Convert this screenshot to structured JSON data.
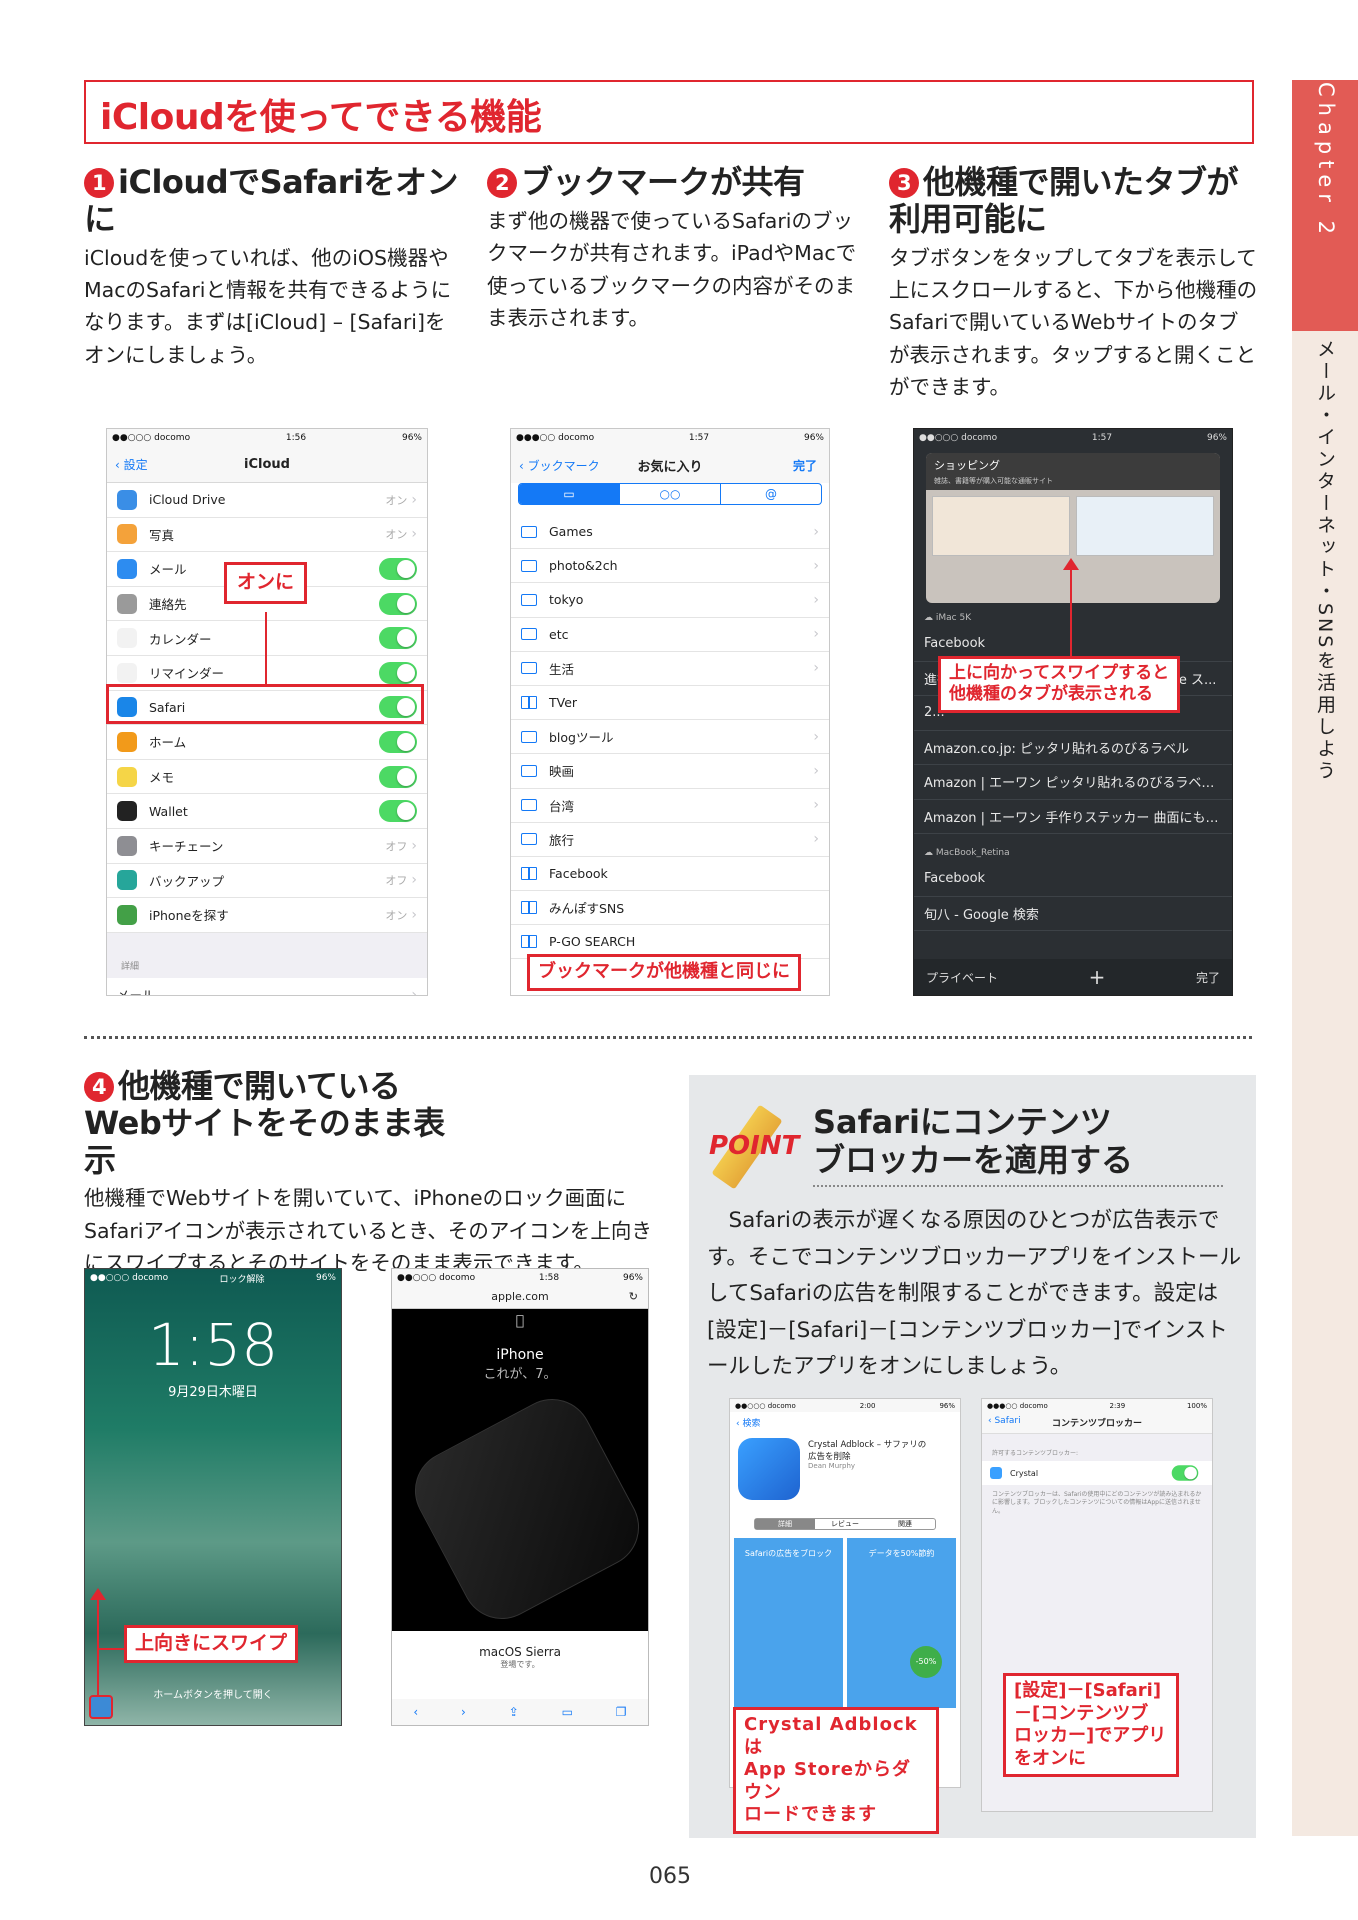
{
  "chapter": "Chapter 2",
  "category": "メール・インターネット・SNSを活用しよう",
  "page_number": "065",
  "main_title": "iCloudを使ってできる機能",
  "steps": [
    {
      "num": "1",
      "title": "iCloudでSafariをオンに",
      "body": "iCloudを使っていれば、他のiOS機器やMacのSafariと情報を共有できるようになります。まずは[iCloud] – [Safari]をオンにしましょう。"
    },
    {
      "num": "2",
      "title": "ブックマークが共有",
      "body": "まず他の機器で使っているSafariのブックマークが共有されます。iPadやMacで使っているブックマークの内容がそのまま表示されます。"
    },
    {
      "num": "3",
      "title": "他機種で開いたタブが利用可能に",
      "body": "タブボタンをタップしてタブを表示して上にスクロールすると、下から他機種のSafariで開いているWebサイトのタブが表示されます。タップすると開くことができます。"
    },
    {
      "num": "4",
      "title": "他機種で開いているWebサイトをそのまま表示",
      "body": "他機種でWebサイトを開いていて、iPhoneのロック画面にSafariアイコンが表示されているとき、そのアイコンを上向きにスワイプするとそのサイトをそのまま表示できます。"
    }
  ],
  "phone1": {
    "status": {
      "carrier": "●●○○○ docomo",
      "time": "1:56",
      "battery": "96%"
    },
    "back": "設定",
    "title": "iCloud",
    "rows": [
      {
        "label": "iCloud Drive",
        "value": "オン",
        "icon": "cloud-icon",
        "color": "#3a8ee6"
      },
      {
        "label": "写真",
        "value": "オン",
        "icon": "photos-icon",
        "color": "#f4a23a"
      },
      {
        "label": "メール",
        "toggle": true,
        "icon": "mail-icon",
        "color": "#2d8cf0"
      },
      {
        "label": "連絡先",
        "toggle": true,
        "icon": "contacts-icon",
        "color": "#9a9a9a"
      },
      {
        "label": "カレンダー",
        "toggle": true,
        "icon": "calendar-icon",
        "color": "#f2f2f2"
      },
      {
        "label": "リマインダー",
        "toggle": true,
        "icon": "reminders-icon",
        "color": "#f2f2f2"
      },
      {
        "label": "Safari",
        "toggle": true,
        "icon": "safari-icon",
        "color": "#1a86e8"
      },
      {
        "label": "ホーム",
        "toggle": true,
        "icon": "home-icon",
        "color": "#f29a1a"
      },
      {
        "label": "メモ",
        "toggle": true,
        "icon": "notes-icon",
        "color": "#f5d547"
      },
      {
        "label": "Wallet",
        "toggle": true,
        "icon": "wallet-icon",
        "color": "#222"
      },
      {
        "label": "キーチェーン",
        "value": "オフ",
        "icon": "keychain-icon",
        "color": "#8e8e93"
      },
      {
        "label": "バックアップ",
        "value": "オフ",
        "icon": "backup-icon",
        "color": "#26a69a"
      },
      {
        "label": "iPhoneを探す",
        "value": "オン",
        "icon": "find-iphone-icon",
        "color": "#43a047"
      }
    ],
    "section": "詳細",
    "footer_row": "メール",
    "callout": "オンに"
  },
  "phone2": {
    "status": {
      "carrier": "●●●○○ docomo",
      "time": "1:57",
      "battery": "96%"
    },
    "back": "ブックマーク",
    "title": "お気に入り",
    "done": "完了",
    "tabs": [
      "book-icon",
      "glasses-icon",
      "at-icon"
    ],
    "rows": [
      {
        "label": "Games",
        "type": "folder"
      },
      {
        "label": "photo&2ch",
        "type": "folder"
      },
      {
        "label": "tokyo",
        "type": "folder"
      },
      {
        "label": "etc",
        "type": "folder"
      },
      {
        "label": "生活",
        "type": "folder"
      },
      {
        "label": "TVer",
        "type": "book"
      },
      {
        "label": "blogツール",
        "type": "folder"
      },
      {
        "label": "映画",
        "type": "folder"
      },
      {
        "label": "台湾",
        "type": "folder"
      },
      {
        "label": "旅行",
        "type": "folder"
      },
      {
        "label": "Facebook",
        "type": "book"
      },
      {
        "label": "みんぽすSNS",
        "type": "book"
      },
      {
        "label": "P-GO SEARCH",
        "type": "book"
      }
    ],
    "callout": "ブックマークが他機種と同じに"
  },
  "phone3": {
    "status": {
      "carrier": "●●○○○ docomo",
      "time": "1:57",
      "battery": "96%"
    },
    "card_title": "ショッピング",
    "card_sub": "雑誌、書籍等が購入可能な通販サイト",
    "device_label": "iMac 5K",
    "rows": [
      "Facebook",
      "進行 MacBookスタ... Sierra xlex... Google ス...",
      "2...",
      "Amazon.co.jp: ピッタリ貼れるのびるラベル",
      "Amazon | エーワン ピッタリ貼れるのびるラベ…",
      "Amazon | エーワン 手作りステッカー 曲面にも…"
    ],
    "device2": "MacBook_Retina",
    "rows2": [
      "Facebook",
      "旬八 - Google 検索"
    ],
    "bottom": {
      "left": "プライベート",
      "plus": "+",
      "right": "完了"
    },
    "callout": "上に向かってスワイプすると\n他機種のタブが表示される"
  },
  "phone4": {
    "status": {
      "carrier": "●●○○○ docomo",
      "lock": "ロック解除",
      "battery": "96%"
    },
    "time": "1:58",
    "date": "9月29日木曜日",
    "hint": "ホームボタンを押して開く",
    "callout": "上向きにスワイプ"
  },
  "phone5": {
    "status": {
      "carrier": "●●○○○ docomo",
      "time": "1:58",
      "battery": "96%"
    },
    "url": "apple.com",
    "product": "iPhone",
    "tagline": "これが、7。",
    "footer_title": "macOS Sierra",
    "footer_sub": "登場です。"
  },
  "point": {
    "label": "POINT",
    "title": "Safariにコンテンツ\nブロッカーを適用する",
    "body": "Safariの表示が遅くなる原因のひとつが広告表示です。そこでコンテンツブロッカーアプリをインストールしてSafariの広告を制限することができます。設定は[設定]－[Safari]－[コンテンツブロッカー]でインストールしたアプリをオンにしましょう。",
    "phoneA": {
      "status": {
        "carrier": "●●○○○ docomo",
        "time": "2:00",
        "battery": "96%"
      },
      "back": "検索",
      "app_name": "Crystal Adblock – サファリの広告を削除",
      "dev": "Dean Murphy",
      "tabs": [
        "詳細",
        "レビュー",
        "関連"
      ],
      "shot1": "Safariの広告をブロック",
      "shot2": "データを50%節約",
      "badge": "-50%",
      "callout": "Crystal Adblockは\nApp Storeからダウン\nロードできます"
    },
    "phoneB": {
      "status": {
        "carrier": "●●●○○ docomo",
        "time": "2:39",
        "battery": "100%"
      },
      "back": "Safari",
      "title": "コンテンツブロッカー",
      "section": "許可するコンテンツブロッカー:",
      "item": "Crystal",
      "note": "コンテンツブロッカーは、Safariの使用中にどのコンテンツが読み込まれるかに影響します。ブロックしたコンテンツについての情報はAppに送信されません。",
      "callout": "[設定]－[Safari]\n－[コンテンツブ\nロッカー]でアプリ\nをオンに"
    }
  },
  "colors": {
    "accent": "#e0262f",
    "sidebar_red": "#e25b55",
    "sidebar_bg": "#f4e9e1",
    "point_bg": "#e6e8ea",
    "ios_blue": "#1479f6",
    "ios_green": "#4cd964"
  }
}
